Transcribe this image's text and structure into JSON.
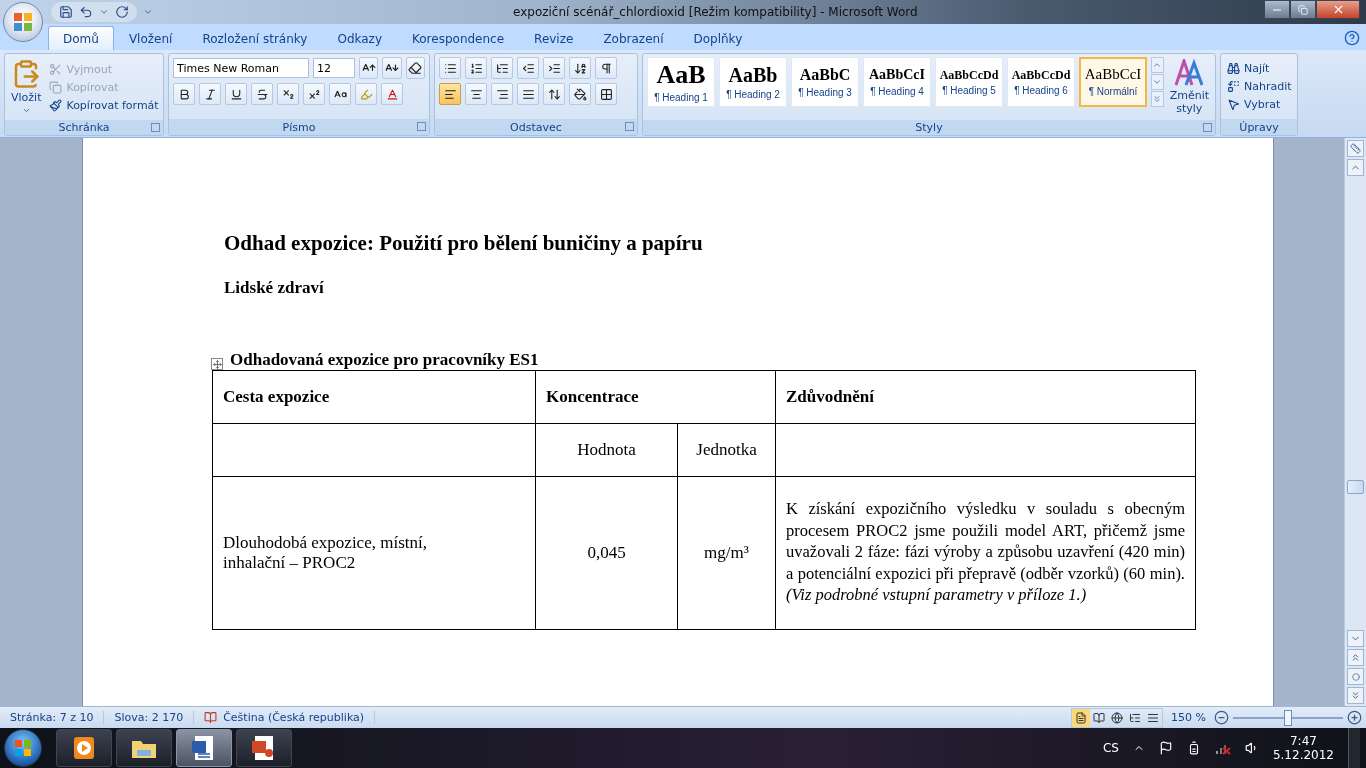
{
  "window": {
    "title": "expoziční scénář_chlordioxid [Režim kompatibility] - Microsoft Word"
  },
  "tabs": [
    {
      "label": "Domů",
      "selected": true
    },
    {
      "label": "Vložení",
      "selected": false
    },
    {
      "label": "Rozložení stránky",
      "selected": false
    },
    {
      "label": "Odkazy",
      "selected": false
    },
    {
      "label": "Korespondence",
      "selected": false
    },
    {
      "label": "Revize",
      "selected": false
    },
    {
      "label": "Zobrazení",
      "selected": false
    },
    {
      "label": "Doplňky",
      "selected": false
    }
  ],
  "ribbon": {
    "clipboard": {
      "title": "Schránka",
      "paste": "Vložit",
      "items": [
        {
          "kind": "cut",
          "label": "Vyjmout",
          "disabled": true
        },
        {
          "kind": "copy",
          "label": "Kopírovat",
          "disabled": true
        },
        {
          "kind": "painter",
          "label": "Kopírovat formát",
          "disabled": false
        }
      ]
    },
    "font": {
      "title": "Písmo",
      "font_name": "Times New Roman",
      "font_size": "12"
    },
    "paragraph": {
      "title": "Odstavec",
      "alignment": [
        {
          "kind": "left",
          "selected": true
        },
        {
          "kind": "center",
          "selected": false
        },
        {
          "kind": "right",
          "selected": false
        },
        {
          "kind": "justify",
          "selected": false
        }
      ]
    },
    "styles": {
      "title": "Styly",
      "change_styles": "Změnit styly",
      "items": [
        {
          "preview": "AaB",
          "label": "¶ Heading 1",
          "selected": false,
          "kind": "h1"
        },
        {
          "preview": "AaBb",
          "label": "¶ Heading 2",
          "selected": false,
          "kind": "h2"
        },
        {
          "preview": "AaBbC",
          "label": "¶ Heading 3",
          "selected": false,
          "kind": "h3"
        },
        {
          "preview": "AaBbCcI",
          "label": "¶ Heading 4",
          "selected": false,
          "kind": "h4"
        },
        {
          "preview": "AaBbCcDd",
          "label": "¶ Heading 5",
          "selected": false,
          "kind": "h5"
        },
        {
          "preview": "AaBbCcDd",
          "label": "¶ Heading 6",
          "selected": false,
          "kind": "h6"
        },
        {
          "preview": "AaBbCcI",
          "label": "¶ Normální",
          "selected": true,
          "kind": "normal"
        }
      ]
    },
    "editing": {
      "title": "Úpravy",
      "items": [
        {
          "kind": "find",
          "label": "Najít"
        },
        {
          "kind": "replace",
          "label": "Nahradit"
        },
        {
          "kind": "select",
          "label": "Vybrat"
        }
      ]
    }
  },
  "document": {
    "heading": "Odhad expozice: Použití pro bělení buničiny a papíru",
    "subheading": "Lidské zdraví",
    "table_caption": "Odhadovaná expozice pro pracovníky ES1",
    "table": {
      "header": [
        "Cesta expozice",
        "Koncentrace",
        "Zdůvodnění"
      ],
      "subheader": [
        "Hodnota",
        "Jednotka"
      ],
      "rows": [
        {
          "route": "Dlouhodobá expozice, místní, inhalační – PROC2",
          "value": "0,045",
          "unit": "mg/m³",
          "reason": "K získání expozičního výsledku v souladu s obecným procesem PROC2 jsme použili model ART, přičemž jsme uvažovali 2 fáze: fázi výroby a způsobu uzavření (420 min) a potenciální expozici při přepravě (odběr vzorků) (60 min). *(Viz podrobné vstupní parametry v příloze 1.)*"
        }
      ]
    }
  },
  "status_bar": {
    "page": "Stránka: 7 z 10",
    "words": "Slova: 2 170",
    "language": "Čeština (Česká republika)",
    "zoom": "150 %",
    "zoom_slider": {
      "level": 0.5
    },
    "views": [
      {
        "kind": "print",
        "selected": true
      },
      {
        "kind": "read",
        "selected": false
      },
      {
        "kind": "web",
        "selected": false
      },
      {
        "kind": "outline",
        "selected": false
      },
      {
        "kind": "draft",
        "selected": false
      }
    ]
  },
  "taskbar": {
    "apps": [
      {
        "kind": "media",
        "active": false
      },
      {
        "kind": "explorer",
        "active": false
      },
      {
        "kind": "word",
        "active": true
      },
      {
        "kind": "powerpoint",
        "active": false
      }
    ],
    "language": "CS",
    "time": "7:47",
    "date": "5.12.2012"
  }
}
